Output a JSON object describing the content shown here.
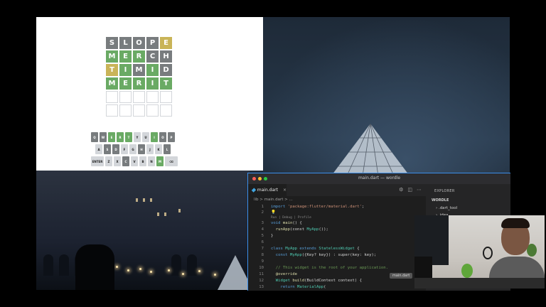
{
  "wordle": {
    "grid": [
      [
        {
          "l": "S",
          "s": "x"
        },
        {
          "l": "L",
          "s": "x"
        },
        {
          "l": "O",
          "s": "x"
        },
        {
          "l": "P",
          "s": "x"
        },
        {
          "l": "E",
          "s": "y"
        }
      ],
      [
        {
          "l": "M",
          "s": "g"
        },
        {
          "l": "E",
          "s": "g"
        },
        {
          "l": "R",
          "s": "g"
        },
        {
          "l": "C",
          "s": "x"
        },
        {
          "l": "H",
          "s": "x"
        }
      ],
      [
        {
          "l": "T",
          "s": "y"
        },
        {
          "l": "I",
          "s": "g"
        },
        {
          "l": "M",
          "s": "x"
        },
        {
          "l": "I",
          "s": "g"
        },
        {
          "l": "D",
          "s": "x"
        }
      ],
      [
        {
          "l": "M",
          "s": "g"
        },
        {
          "l": "E",
          "s": "g"
        },
        {
          "l": "R",
          "s": "g"
        },
        {
          "l": "I",
          "s": "g"
        },
        {
          "l": "T",
          "s": "g"
        }
      ],
      [
        {
          "l": "",
          "s": "e"
        },
        {
          "l": "",
          "s": "e"
        },
        {
          "l": "",
          "s": "e"
        },
        {
          "l": "",
          "s": "e"
        },
        {
          "l": "",
          "s": "e"
        }
      ],
      [
        {
          "l": "",
          "s": "e"
        },
        {
          "l": "",
          "s": "e"
        },
        {
          "l": "",
          "s": "e"
        },
        {
          "l": "",
          "s": "e"
        },
        {
          "l": "",
          "s": "e"
        }
      ]
    ],
    "keyboard": [
      [
        {
          "k": "Q",
          "s": "x"
        },
        {
          "k": "W",
          "s": "x"
        },
        {
          "k": "E",
          "s": "g"
        },
        {
          "k": "R",
          "s": "g"
        },
        {
          "k": "T",
          "s": "g"
        },
        {
          "k": "Y",
          "s": "u"
        },
        {
          "k": "U",
          "s": "u"
        },
        {
          "k": "I",
          "s": "g"
        },
        {
          "k": "O",
          "s": "x"
        },
        {
          "k": "P",
          "s": "x"
        }
      ],
      [
        {
          "k": "A",
          "s": "u"
        },
        {
          "k": "S",
          "s": "x"
        },
        {
          "k": "D",
          "s": "x"
        },
        {
          "k": "F",
          "s": "u"
        },
        {
          "k": "G",
          "s": "u"
        },
        {
          "k": "H",
          "s": "x"
        },
        {
          "k": "J",
          "s": "u"
        },
        {
          "k": "K",
          "s": "u"
        },
        {
          "k": "L",
          "s": "x"
        }
      ],
      [
        {
          "k": "ENTER",
          "s": "u",
          "wide": true
        },
        {
          "k": "Z",
          "s": "u"
        },
        {
          "k": "X",
          "s": "u"
        },
        {
          "k": "C",
          "s": "x"
        },
        {
          "k": "V",
          "s": "u"
        },
        {
          "k": "B",
          "s": "u"
        },
        {
          "k": "N",
          "s": "u"
        },
        {
          "k": "M",
          "s": "g"
        },
        {
          "k": "⌫",
          "s": "u",
          "wide": true
        }
      ]
    ],
    "colors": {
      "correct": "#6aaa64",
      "present": "#c9b458",
      "absent": "#787c7e"
    }
  },
  "vscode": {
    "window_title": "main.dart — wordle",
    "tab_label": "main.dart",
    "breadcrumb": "lib  >  main.dart  >  ...",
    "explorer_title": "EXPLORER",
    "explorer_items": [
      "WORDLE",
      "›  .dart_tool",
      "›  .idea"
    ],
    "tooltip": "main.dart",
    "line_numbers": [
      "1",
      "2",
      "3",
      "4",
      "5",
      "6",
      "7",
      "8",
      "9",
      "10",
      "11",
      "12",
      "13"
    ],
    "codelens": "Run | Debug | Profile",
    "code": {
      "l1_kw": "import",
      "l1_str": "'package:flutter/material.dart'",
      "l1_end": ";",
      "l3_kw": "void",
      "l3_fn": " main",
      "l3_rest": "() {",
      "l4_fn": "  runApp",
      "l4_rest": "(const ",
      "l4_cls": "MyApp",
      "l4_end": "());",
      "l5": "}",
      "l7_kw": "class",
      "l7_cls": " MyApp",
      "l7_kw2": " extends",
      "l7_cls2": " StatelessWidget",
      "l7_end": " {",
      "l8_kw": "  const",
      "l8_cls": " MyApp",
      "l8_rest": "({Key? key}) : super(key: key);",
      "l10": "  // This widget is the root of your application.",
      "l11": "  @override",
      "l12_cls": "  Widget",
      "l12_fn": " build",
      "l12_rest": "(BuildContext context) {",
      "l13_kw": "    return",
      "l13_cls": " MaterialApp",
      "l13_end": "("
    }
  }
}
